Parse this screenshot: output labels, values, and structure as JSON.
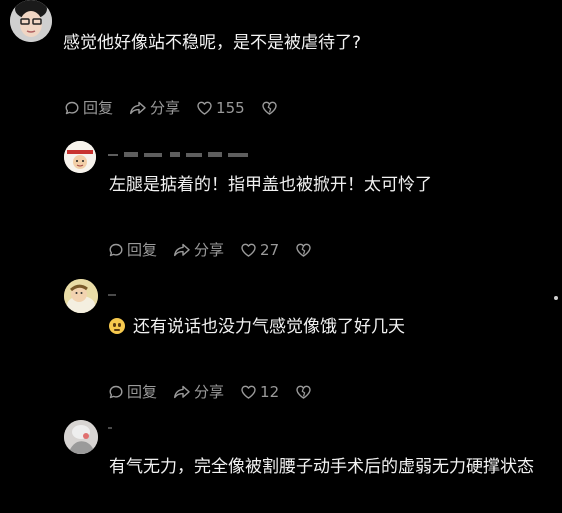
{
  "comments": [
    {
      "text": "感觉他好像站不稳呢，是不是被虐待了?",
      "reply_label": "回复",
      "share_label": "分享",
      "like_count": "155"
    },
    {
      "text": "左腿是掂着的！指甲盖也被掀开！太可怜了",
      "reply_label": "回复",
      "share_label": "分享",
      "like_count": "27"
    },
    {
      "emoji": "fearful-face-emoji",
      "text": "还有说话也没力气感觉像饿了好几天",
      "reply_label": "回复",
      "share_label": "分享",
      "like_count": "12"
    },
    {
      "text": "有气无力，完全像被割腰子动手术后的虚弱无力硬撑状态"
    }
  ],
  "colors": {
    "background": "#000000",
    "text": "#f2f2f2",
    "action": "#9a9a9a"
  }
}
